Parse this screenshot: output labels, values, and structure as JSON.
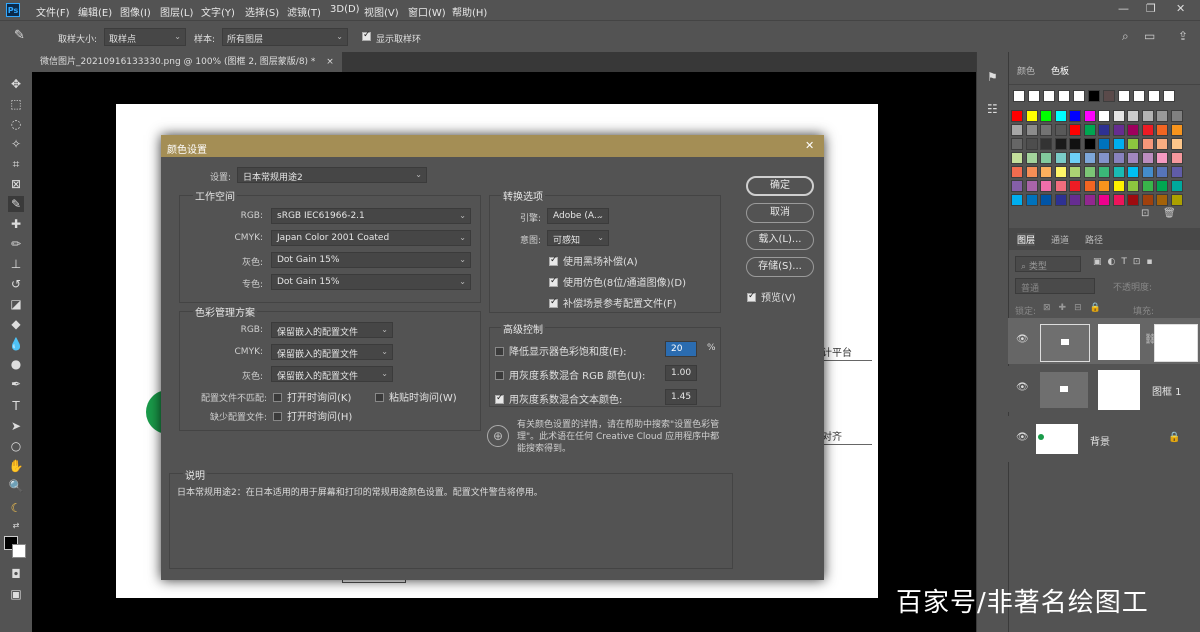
{
  "menubar": {
    "logo": "Ps",
    "items": [
      "文件(F)",
      "编辑(E)",
      "图像(I)",
      "图层(L)",
      "文字(Y)",
      "选择(S)",
      "滤镜(T)",
      "3D(D)",
      "视图(V)",
      "窗口(W)",
      "帮助(H)"
    ],
    "window_controls": [
      "—",
      "❐",
      "✕"
    ]
  },
  "options": {
    "sample_size_label": "取样大小:",
    "sample_size_value": "取样点",
    "sample_label": "样本:",
    "sample_value": "所有图层",
    "show_ring_label": "显示取样环",
    "show_ring_checked": true
  },
  "document": {
    "tab_title": "微信图片_20210916133330.png @ 100% (图框 2, 图层蒙版/8) *",
    "tab_close": "×",
    "bg_texts": [
      "计平台",
      "对齐"
    ]
  },
  "panels": {
    "swatch_tabs": [
      "颜色",
      "色板"
    ],
    "layer_tabs": [
      "图层",
      "通道",
      "路径"
    ],
    "layer_kind_label": "类型",
    "blend_mode": "普通",
    "opacity_label": "不透明度:",
    "lock_label": "锁定:",
    "fill_label": "填充:",
    "layers": [
      {
        "name": ""
      },
      {
        "name": "图框 1"
      },
      {
        "name": "背景"
      }
    ]
  },
  "swatches": {
    "row1": [
      "#ffffff",
      "#ffffff",
      "#ffffff",
      "#ffffff",
      "#ffffff",
      "#000000",
      "#5a4a4a",
      "#ffffff",
      "#ffffff",
      "#ffffff",
      "#ffffff"
    ],
    "grid": [
      [
        "#ff0000",
        "#ffff00",
        "#00ff00",
        "#00ffff",
        "#0000ff",
        "#ff00ff",
        "#ffffff",
        "#e6e6e6",
        "#cccccc",
        "#b3b3b3",
        "#999999",
        "#808080"
      ],
      [
        "#a6a6a6",
        "#8c8c8c",
        "#737373",
        "#595959",
        "#ff0000",
        "#00a651",
        "#2e3192",
        "#662d91",
        "#9e005d",
        "#ed1c24",
        "#f26522",
        "#f7941d"
      ],
      [
        "#666666",
        "#4d4d4d",
        "#333333",
        "#1a1a1a",
        "#111111",
        "#000000",
        "#0072bc",
        "#00aeef",
        "#8dc63f",
        "#f7977a",
        "#f9ad81",
        "#fdc68a"
      ],
      [
        "#c4df9b",
        "#a3d39c",
        "#82ca9d",
        "#7accc8",
        "#6dcff6",
        "#7da7d9",
        "#8393ca",
        "#8882be",
        "#a187be",
        "#bc8dbf",
        "#f49ac2",
        "#f6989d"
      ],
      [
        "#f26c4f",
        "#f68e56",
        "#fbaf5d",
        "#fff568",
        "#acd373",
        "#7cc576",
        "#3bb878",
        "#1abbb4",
        "#00bff3",
        "#448ccb",
        "#5674b9",
        "#605ca8"
      ],
      [
        "#855fa8",
        "#a864a8",
        "#f06eaa",
        "#f26d7d",
        "#ed1c24",
        "#f26522",
        "#f7941d",
        "#fff200",
        "#8dc63f",
        "#39b54a",
        "#00a651",
        "#00a99d"
      ],
      [
        "#00aeef",
        "#0072bc",
        "#0054a6",
        "#2e3192",
        "#662d91",
        "#92278f",
        "#ec008c",
        "#ed145b",
        "#9e0b0f",
        "#a0410d",
        "#a36209",
        "#aba000"
      ]
    ]
  },
  "dialog": {
    "title": "颜色设置",
    "close": "✕",
    "settings_label": "设置:",
    "settings_value": "日本常规用途2",
    "workspace": {
      "title": "工作空间",
      "rows": [
        {
          "label": "RGB:",
          "value": "sRGB IEC61966-2.1"
        },
        {
          "label": "CMYK:",
          "value": "Japan Color 2001 Coated"
        },
        {
          "label": "灰色:",
          "value": "Dot Gain 15%"
        },
        {
          "label": "专色:",
          "value": "Dot Gain 15%"
        }
      ]
    },
    "policies": {
      "title": "色彩管理方案",
      "rows": [
        {
          "label": "RGB:",
          "value": "保留嵌入的配置文件"
        },
        {
          "label": "CMYK:",
          "value": "保留嵌入的配置文件"
        },
        {
          "label": "灰色:",
          "value": "保留嵌入的配置文件"
        }
      ],
      "mismatch_label": "配置文件不匹配:",
      "ask_open": "打开时询问(K)",
      "ask_paste": "粘贴时询问(W)",
      "missing_label": "缺少配置文件:",
      "missing_ask_open": "打开时询问(H)"
    },
    "conversion": {
      "title": "转换选项",
      "engine_label": "引擎:",
      "engine_value": "Adobe (A...",
      "intent_label": "意图:",
      "intent_value": "可感知",
      "bpc": "使用黑场补偿(A)",
      "dither": "使用仿色(8位/通道图像)(D)",
      "compensate": "补偿场景参考配置文件(F)"
    },
    "advanced": {
      "title": "高级控制",
      "desaturate": "降低显示器色彩饱和度(E):",
      "desaturate_value": "20",
      "desaturate_unit": "%",
      "blend_rgb": "用灰度系数混合 RGB 颜色(U):",
      "blend_rgb_value": "1.00",
      "blend_text": "用灰度系数混合文本颜色:",
      "blend_text_value": "1.45"
    },
    "info_text": "有关颜色设置的详情，请在帮助中搜索\"设置色彩管理\"。此术语在任何 Creative Cloud 应用程序中都能搜索得到。",
    "description": {
      "title": "说明",
      "text": "日本常规用途2：在日本适用的用于屏幕和打印的常规用途颜色设置。配置文件警告将停用。"
    },
    "buttons": {
      "ok": "确定",
      "cancel": "取消",
      "load": "载入(L)...",
      "save": "存储(S)...",
      "preview": "预览(V)"
    }
  },
  "watermark": "百家号/非著名绘图工"
}
